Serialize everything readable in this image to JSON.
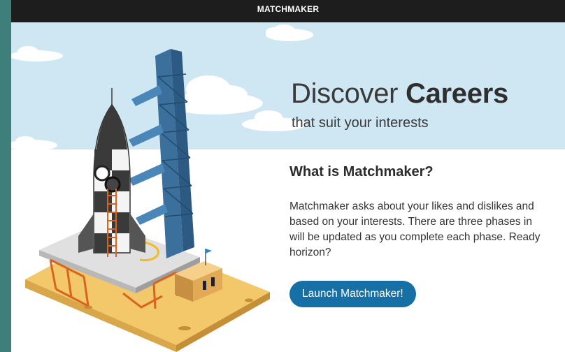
{
  "topbar": {
    "title": "MATCHMAKER"
  },
  "hero": {
    "title_light": "Discover ",
    "title_bold": "Careers",
    "subtitle": "that suit your interests"
  },
  "about": {
    "heading": "What is Matchmaker?",
    "lines": [
      "Matchmaker asks about your likes and dislikes and",
      "based on your interests. There are three phases in",
      "will be updated as you complete each phase. Ready",
      "horizon?"
    ]
  },
  "actions": {
    "launch_label": "Launch Matchmaker!"
  },
  "colors": {
    "page_border": "#3e7f7c",
    "topbar": "#1d1d1d",
    "sky": "#cfe7f3",
    "button": "#1670a6"
  },
  "illustration": {
    "subject": "rocket on launch pad with blue gantry tower",
    "icons": [
      "cloud-icon",
      "flag-icon"
    ]
  }
}
